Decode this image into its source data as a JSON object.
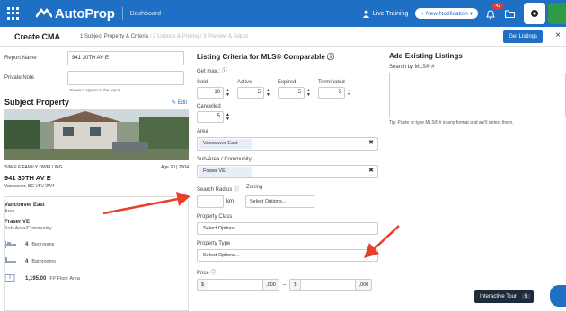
{
  "nav": {
    "logo": "AutoProp",
    "dashboard": "Dashboard",
    "live_training": "Live Training",
    "new_notification": "+ New Notification ▾",
    "bell_badge": "42"
  },
  "subheader": {
    "title": "Create CMA",
    "step_active": "1 Subject Property & Criteria",
    "step_rest": "/ 2 Listings & Pricing / 3 Preview & Adjust",
    "get_listings": "Get Listings",
    "close": "×"
  },
  "left": {
    "report_name_label": "Report Name",
    "report_name_value": "941 30TH AV E",
    "private_note_label": "Private Note",
    "private_note_sub": "*Doesn't appear in the report",
    "subject_title": "Subject Property",
    "edit": "Edit",
    "dwelling": "SINGLE FAMILY DWELLING",
    "age": "Age 20 | 2004",
    "address": "941 30TH AV E",
    "city": "Vancouver, BC V5V 2W4",
    "area_value": "Vancouver East",
    "area_label": "Area",
    "subarea_value": "Fraser VE",
    "subarea_label": "Sub-Area/Community",
    "bedrooms_value": "4",
    "bedrooms_label": "Bedrooms",
    "bathrooms_value": "4",
    "bathrooms_label": "Bathrooms",
    "floor_value": "1,195.00",
    "floor_label": "Ft² Floor Area"
  },
  "criteria": {
    "title": "Listing Criteria for MLS® Comparable",
    "get_max": "Get max.:",
    "headers": [
      "Sold",
      "Active",
      "Expired",
      "Terminated"
    ],
    "values": [
      "10",
      "5",
      "5",
      "5"
    ],
    "cancelled_label": "Cancelled",
    "cancelled_value": "5",
    "area_label": "Area",
    "area_tag": "Vancouver East",
    "subarea_label": "Sub-Area / Community",
    "subarea_tag": "Fraser VE",
    "radius_label": "Search Radius",
    "zoning_label": "Zoning",
    "km": "km",
    "select_options": "Select Options...",
    "property_class_label": "Property Class",
    "property_type_label": "Property Type",
    "price_label": "Price",
    "currency": "$",
    "suffix": ",000",
    "dash": "–"
  },
  "existing": {
    "title": "Add Existing Listings",
    "search_label": "Search by MLS® #",
    "tip": "Tip: Paste or type MLS® # in any format and we'll detect them."
  },
  "tour": {
    "label": "Interactive Tour",
    "count": "5"
  },
  "colors": {
    "brand_blue": "#1f6fc5",
    "arrow_red": "#e8402a"
  }
}
